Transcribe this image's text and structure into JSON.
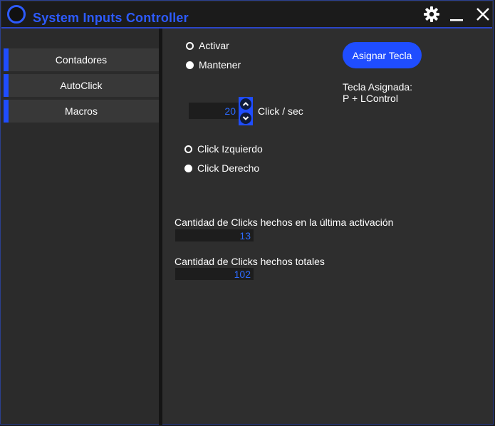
{
  "app": {
    "title": "System Inputs Controller",
    "accent_color": "#1f4dff",
    "icons": [
      "app-logo-icon",
      "gear-icon",
      "minimize-icon",
      "close-icon"
    ]
  },
  "sidebar": {
    "items": [
      {
        "label": "Contadores"
      },
      {
        "label": "AutoClick"
      },
      {
        "label": "Macros"
      }
    ]
  },
  "main": {
    "mode_options": [
      {
        "label": "Activar",
        "selected": false
      },
      {
        "label": "Mantener",
        "selected": true
      }
    ],
    "assign_button": "Asignar Tecla",
    "assigned_key_label": "Tecla Asignada:",
    "assigned_key_value": "P + LControl",
    "click_rate": {
      "value": "20",
      "unit": "Click / sec"
    },
    "button_options": [
      {
        "label": "Click Izquierdo",
        "selected": false
      },
      {
        "label": "Click Derecho",
        "selected": true
      }
    ],
    "last_activation": {
      "label": "Cantidad de Clicks hechos en la última activación",
      "value": "13"
    },
    "total": {
      "label": "Cantidad de Clicks hechos totales",
      "value": "102"
    }
  }
}
